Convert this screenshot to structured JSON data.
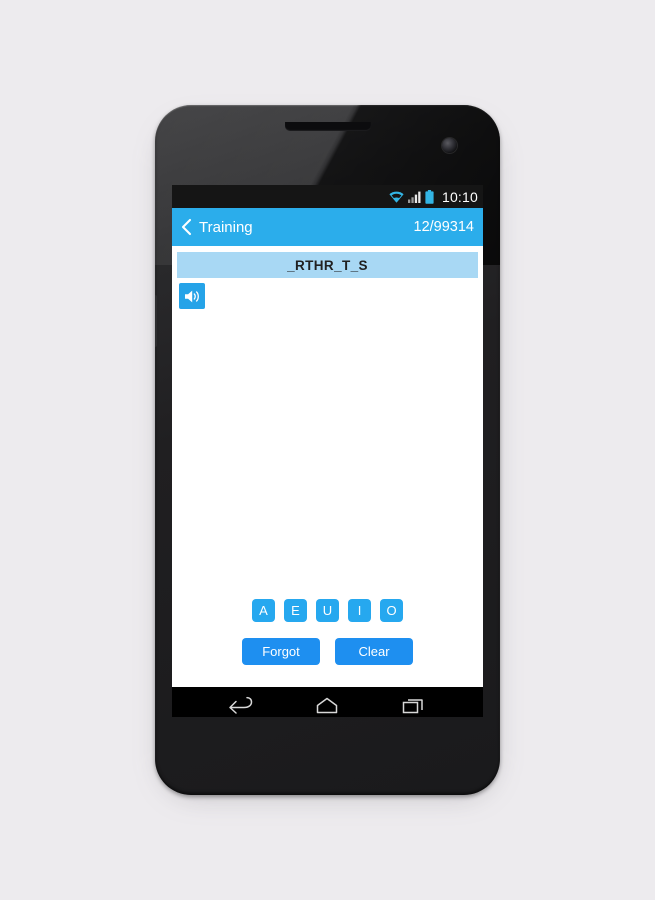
{
  "background_color": "#edebee",
  "device": {
    "name": "android-phone-mockup",
    "body_color": "#201f21",
    "earpiece": "earpiece-speaker",
    "camera": "front-camera-lens"
  },
  "statusbar": {
    "time": "10:10",
    "icons": [
      "wifi-icon",
      "signal-icon",
      "battery-icon"
    ],
    "background_color": "#151515"
  },
  "actionbar": {
    "back_icon": "chevron-left-icon",
    "title": "Training",
    "counter": "12/99314",
    "background_color": "#2badeb",
    "text_color": "#ffffff"
  },
  "content": {
    "word": "_RTHR_T_S",
    "word_bar_color": "#a8d8f4",
    "speaker_button": {
      "icon": "speaker-icon",
      "color": "#25a3e8"
    },
    "letters": [
      "A",
      "E",
      "U",
      "I",
      "O"
    ],
    "letter_key_color": "#26a8ef",
    "actions": [
      {
        "label": "Forgot",
        "name": "forgot-button"
      },
      {
        "label": "Clear",
        "name": "clear-button"
      }
    ],
    "action_button_color": "#1e8ff0"
  },
  "navbar": {
    "keys": [
      "back-nav-icon",
      "home-nav-icon",
      "recents-nav-icon"
    ],
    "background_color": "#000000"
  }
}
